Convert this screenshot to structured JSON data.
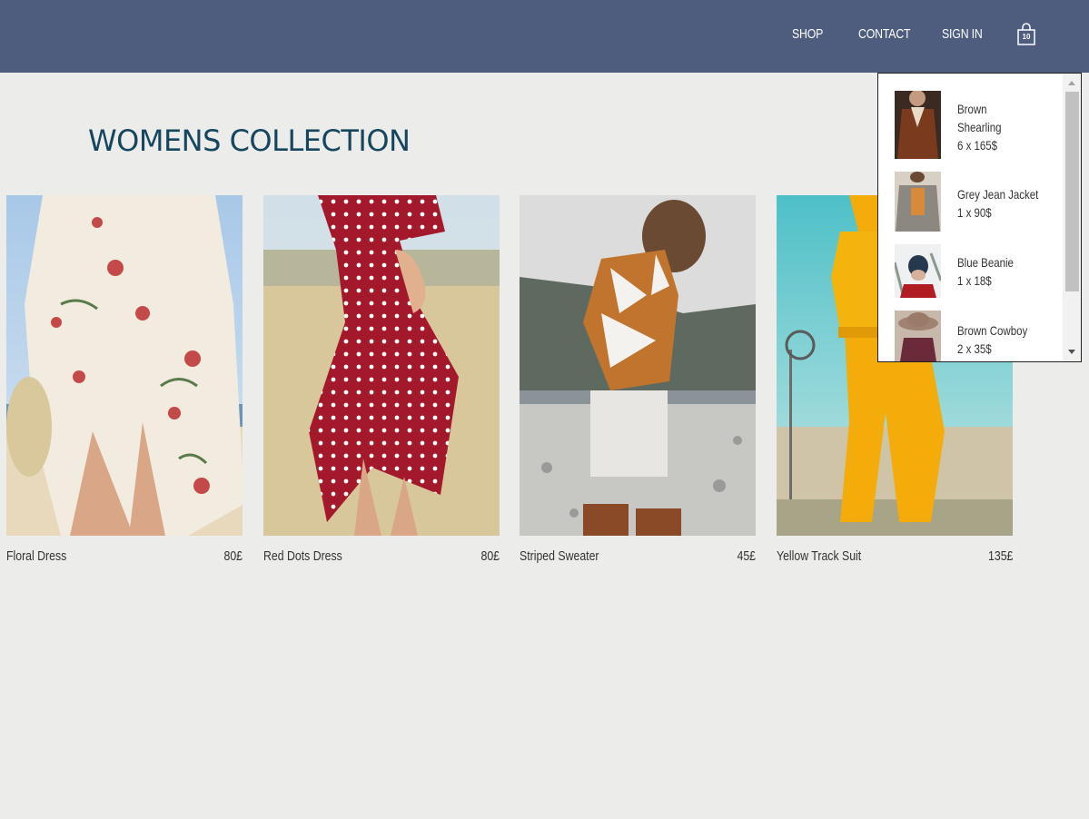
{
  "header": {
    "nav": [
      "SHOP",
      "CONTACT",
      "SIGN IN"
    ],
    "cart_count": "10",
    "bg_color": "#4e5c7e"
  },
  "collection": {
    "title": "WOMENS COLLECTION",
    "title_color": "#16465f",
    "items": [
      {
        "name": "Floral Dress",
        "price": "80£"
      },
      {
        "name": "Red Dots Dress",
        "price": "80£"
      },
      {
        "name": "Striped Sweater",
        "price": "45£"
      },
      {
        "name": "Yellow Track Suit",
        "price": "135£"
      }
    ]
  },
  "cart_dropdown": {
    "items": [
      {
        "name": "Brown Shearling",
        "qty": "6 x 165$"
      },
      {
        "name": "Grey Jean Jacket",
        "qty": "1 x 90$"
      },
      {
        "name": "Blue Beanie",
        "qty": "1 x 18$"
      },
      {
        "name": "Brown Cowboy",
        "qty": "2 x 35$"
      }
    ]
  }
}
